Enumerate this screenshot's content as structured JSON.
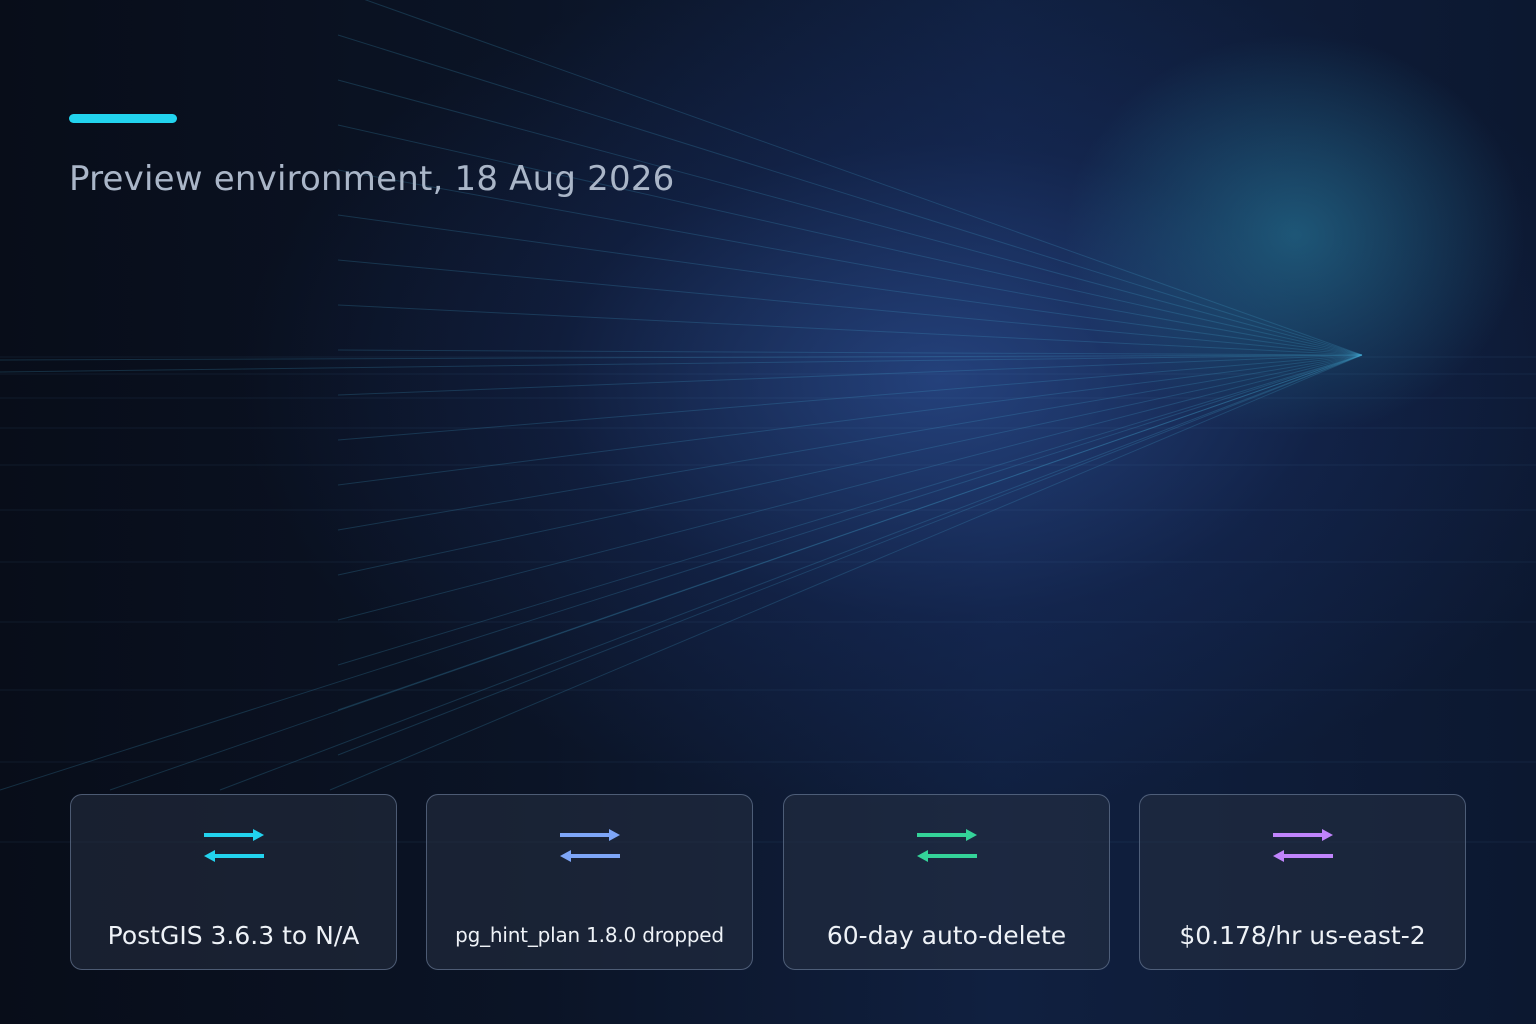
{
  "subtitle": "Preview environment, 18 Aug 2026",
  "colors": {
    "accent": "#22d3ee",
    "card_icon_1": "#22d3ee",
    "card_icon_2": "#7ea6f8",
    "card_icon_3": "#34d399",
    "card_icon_4": "#c084fc"
  },
  "cards": [
    {
      "icon": "swap-arrows-icon",
      "label": "PostGIS 3.6.3 to N/A"
    },
    {
      "icon": "swap-arrows-icon",
      "label": "pg_hint_plan 1.8.0 dropped"
    },
    {
      "icon": "swap-arrows-icon",
      "label": "60-day auto-delete"
    },
    {
      "icon": "swap-arrows-icon",
      "label": "$0.178/hr us-east-2"
    }
  ]
}
